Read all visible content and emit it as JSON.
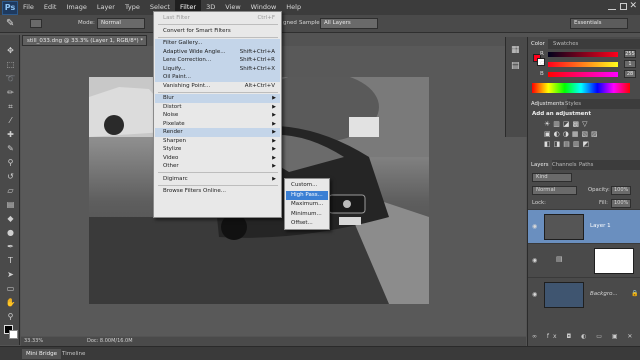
{
  "app": {
    "logo": "Ps"
  },
  "menubar": [
    "File",
    "Edit",
    "Image",
    "Layer",
    "Type",
    "Select",
    "Filter",
    "3D",
    "View",
    "Window",
    "Help"
  ],
  "options_bar": {
    "mode_label": "Mode:",
    "mode_value": "Normal",
    "aligned_label": "gned",
    "sample_label": "Sample:",
    "sample_value": "All Layers",
    "workspace": "Essentials"
  },
  "document_tab": "still_033.dng @ 33.3% (Layer 1, RGB/8*) *",
  "filter_menu": {
    "items": [
      {
        "label": "Last Filter",
        "shortcut": "Ctrl+F",
        "disabled": true
      },
      {
        "sep": true
      },
      {
        "label": "Convert for Smart Filters"
      },
      {
        "sep": true
      },
      {
        "label": "Filter Gallery...",
        "hl": true
      },
      {
        "label": "Adaptive Wide Angle...",
        "shortcut": "Shift+Ctrl+A",
        "hl": true
      },
      {
        "label": "Lens Correction...",
        "shortcut": "Shift+Ctrl+R",
        "hl": true
      },
      {
        "label": "Liquify...",
        "shortcut": "Shift+Ctrl+X",
        "hl": true
      },
      {
        "label": "Oil Paint...",
        "hl": true
      },
      {
        "label": "Vanishing Point...",
        "shortcut": "Alt+Ctrl+V"
      },
      {
        "sep": true
      },
      {
        "label": "Blur",
        "submenu": true,
        "hl": true
      },
      {
        "label": "Distort",
        "submenu": true
      },
      {
        "label": "Noise",
        "submenu": true
      },
      {
        "label": "Pixelate",
        "submenu": true
      },
      {
        "label": "Render",
        "submenu": true,
        "hl": true
      },
      {
        "label": "Sharpen",
        "submenu": true
      },
      {
        "label": "Stylize",
        "submenu": true
      },
      {
        "label": "Video",
        "submenu": true
      },
      {
        "label": "Other",
        "submenu": true
      },
      {
        "sep": true
      },
      {
        "label": "Digimarc",
        "submenu": true
      },
      {
        "sep": true
      },
      {
        "label": "Browse Filters Online..."
      }
    ]
  },
  "other_submenu": [
    "Custom...",
    "High Pass...",
    "Maximum...",
    "Minimum...",
    "Offset..."
  ],
  "other_submenu_selected": 1,
  "color_panel": {
    "tabs": [
      "Color",
      "Swatches"
    ],
    "channels": [
      {
        "label": "R",
        "value": "255"
      },
      {
        "label": "G",
        "value": "1"
      },
      {
        "label": "B",
        "value": "28"
      }
    ]
  },
  "adjustments_panel": {
    "tabs": [
      "Adjustments",
      "Styles"
    ],
    "heading": "Add an adjustment"
  },
  "layers_panel": {
    "tabs": [
      "Layers",
      "Channels",
      "Paths"
    ],
    "kind": "Kind",
    "blend_mode": "Normal",
    "opacity_label": "Opacity:",
    "opacity": "100%",
    "lock_label": "Lock:",
    "fill_label": "Fill:",
    "fill": "100%",
    "layers": [
      "Layer 1",
      "",
      "Backgro..."
    ]
  },
  "status": {
    "zoom": "33.33%",
    "doc": "Doc: 8.00M/16.0M"
  },
  "bottom_tabs": [
    "Mini Bridge",
    "Timeline"
  ]
}
